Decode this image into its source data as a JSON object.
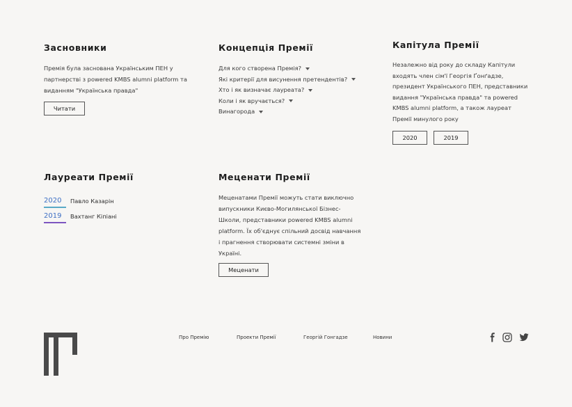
{
  "founders": {
    "title": "Засновники",
    "text": "Премія була заснована Українським ПЕН у партнерстві з powered KMBS alumni platform та виданням \"Українська правда\"",
    "button": "Читати"
  },
  "concept": {
    "title": "Концепція Премії",
    "items": [
      "Для кого створена Премія?",
      "Які критерії для висунення претендентів?",
      "Хто і як визначає лауреата?",
      "Коли і як вручається?",
      "Винагорода"
    ]
  },
  "chapter": {
    "title": "Капітула Премії",
    "text": "Незалежно від року до складу Капітули входять член сім'ї Георгія Ґонґадзе, президент Українського ПЕН, представники видання \"Українська правда\" та powered KMBS alumni platform, а також лауреат Премії минулого року",
    "years": [
      "2020",
      "2019"
    ]
  },
  "laureates": {
    "title": "Лауреати Премії",
    "items": [
      {
        "year": "2020",
        "name": "Павло Казарін",
        "underline": "#59a9c7"
      },
      {
        "year": "2019",
        "name": "Вахтанг Кіпіані",
        "underline": "#7d55c0"
      }
    ]
  },
  "patrons": {
    "title": "Меценати Премії",
    "text": "Меценатами Премії можуть стати виключно випускники Києво-Могилянської Бізнес-Школи, представники powered KMBS alumni platform. Їх об'єднує спільний досвід навчання і прагнення створювати системні зміни в Україні.",
    "button": "Меценати"
  },
  "footer": {
    "nav": [
      "Про Премію",
      "Проекти Премії",
      "Георгій Гонгадзе",
      "Новини"
    ],
    "social_icons": [
      "facebook-icon",
      "instagram-icon",
      "twitter-icon"
    ],
    "logo_color": "#4a4a4a"
  }
}
